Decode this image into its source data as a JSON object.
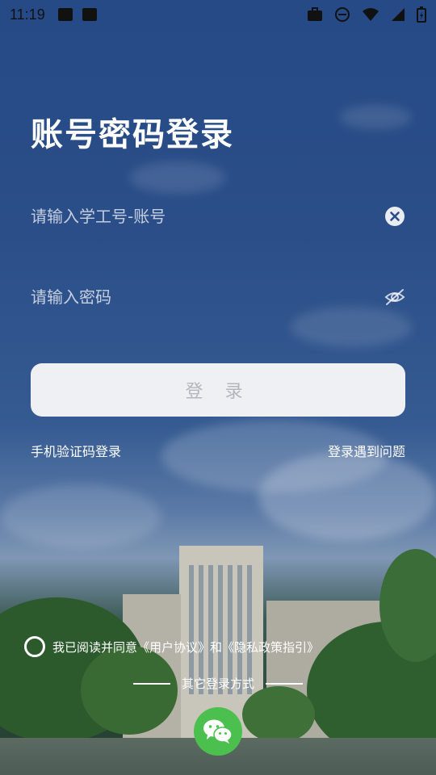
{
  "status_bar": {
    "time": "11:19"
  },
  "title": "账号密码登录",
  "account": {
    "placeholder": "请输入学工号-账号",
    "value": ""
  },
  "password": {
    "placeholder": "请输入密码",
    "value": ""
  },
  "login_button": "登 录",
  "links": {
    "sms_login": "手机验证码登录",
    "login_problem": "登录遇到问题"
  },
  "agreement": {
    "prefix": "我已阅读并同意",
    "user_agreement": "《用户协议》",
    "and": "和",
    "privacy_policy": "《隐私政策指引》",
    "checked": false
  },
  "other_login": "其它登录方式",
  "icons": {
    "clear": "clear-icon",
    "visibility": "eye-off-icon",
    "wechat": "wechat-icon"
  },
  "colors": {
    "button_bg": "#eef0f4",
    "button_text": "#b3b6bd",
    "wechat": "#4cc04f"
  }
}
